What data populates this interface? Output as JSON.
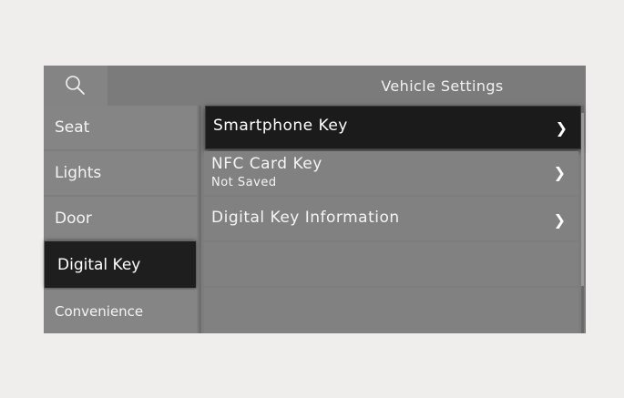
{
  "header": {
    "title": "Vehicle Settings",
    "search_icon": "search-icon"
  },
  "sidebar": {
    "items": [
      {
        "label": "Seat",
        "active": false
      },
      {
        "label": "Lights",
        "active": false
      },
      {
        "label": "Door",
        "active": false
      },
      {
        "label": "Digital Key",
        "active": true
      },
      {
        "label": "Convenience",
        "active": false
      }
    ]
  },
  "list": {
    "rows": [
      {
        "label": "Smartphone Key",
        "sub": "",
        "chevron": "❯",
        "active": true
      },
      {
        "label": "NFC Card Key",
        "sub": "Not Saved",
        "chevron": "❯",
        "active": false
      },
      {
        "label": "Digital Key Information",
        "sub": "",
        "chevron": "❯",
        "active": false
      }
    ]
  },
  "colors": {
    "panel": "#7d7d7d",
    "active": "#1b1b1b",
    "text": "#f4f4f4"
  }
}
